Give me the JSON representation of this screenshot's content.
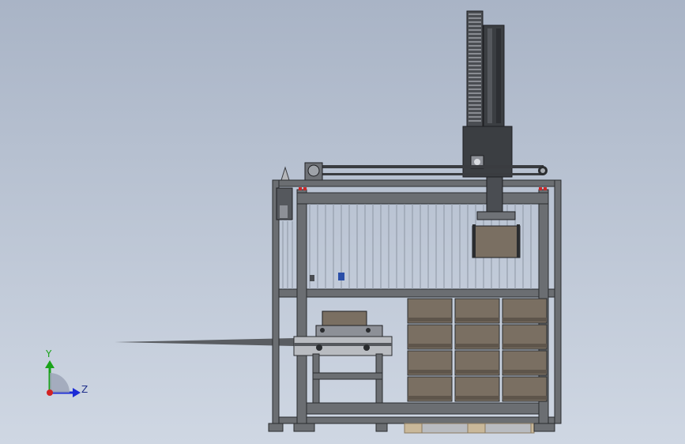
{
  "viewport": {
    "background_top": "#a9b4c6",
    "background_bottom": "#cfd7e3"
  },
  "model": {
    "frame_color": "#6b6e72",
    "frame_edge": "#2a2c2f",
    "guard_line_color": "#8d96a3",
    "column_color": "#3b3e42",
    "box_color": "#7a6f62",
    "pallet_color": "#c9b89a"
  },
  "triad": {
    "y_label": "Y",
    "z_label": "Z",
    "y_color": "#1aa31a",
    "z_color": "#1b2bd6",
    "origin_color": "#d22222"
  }
}
